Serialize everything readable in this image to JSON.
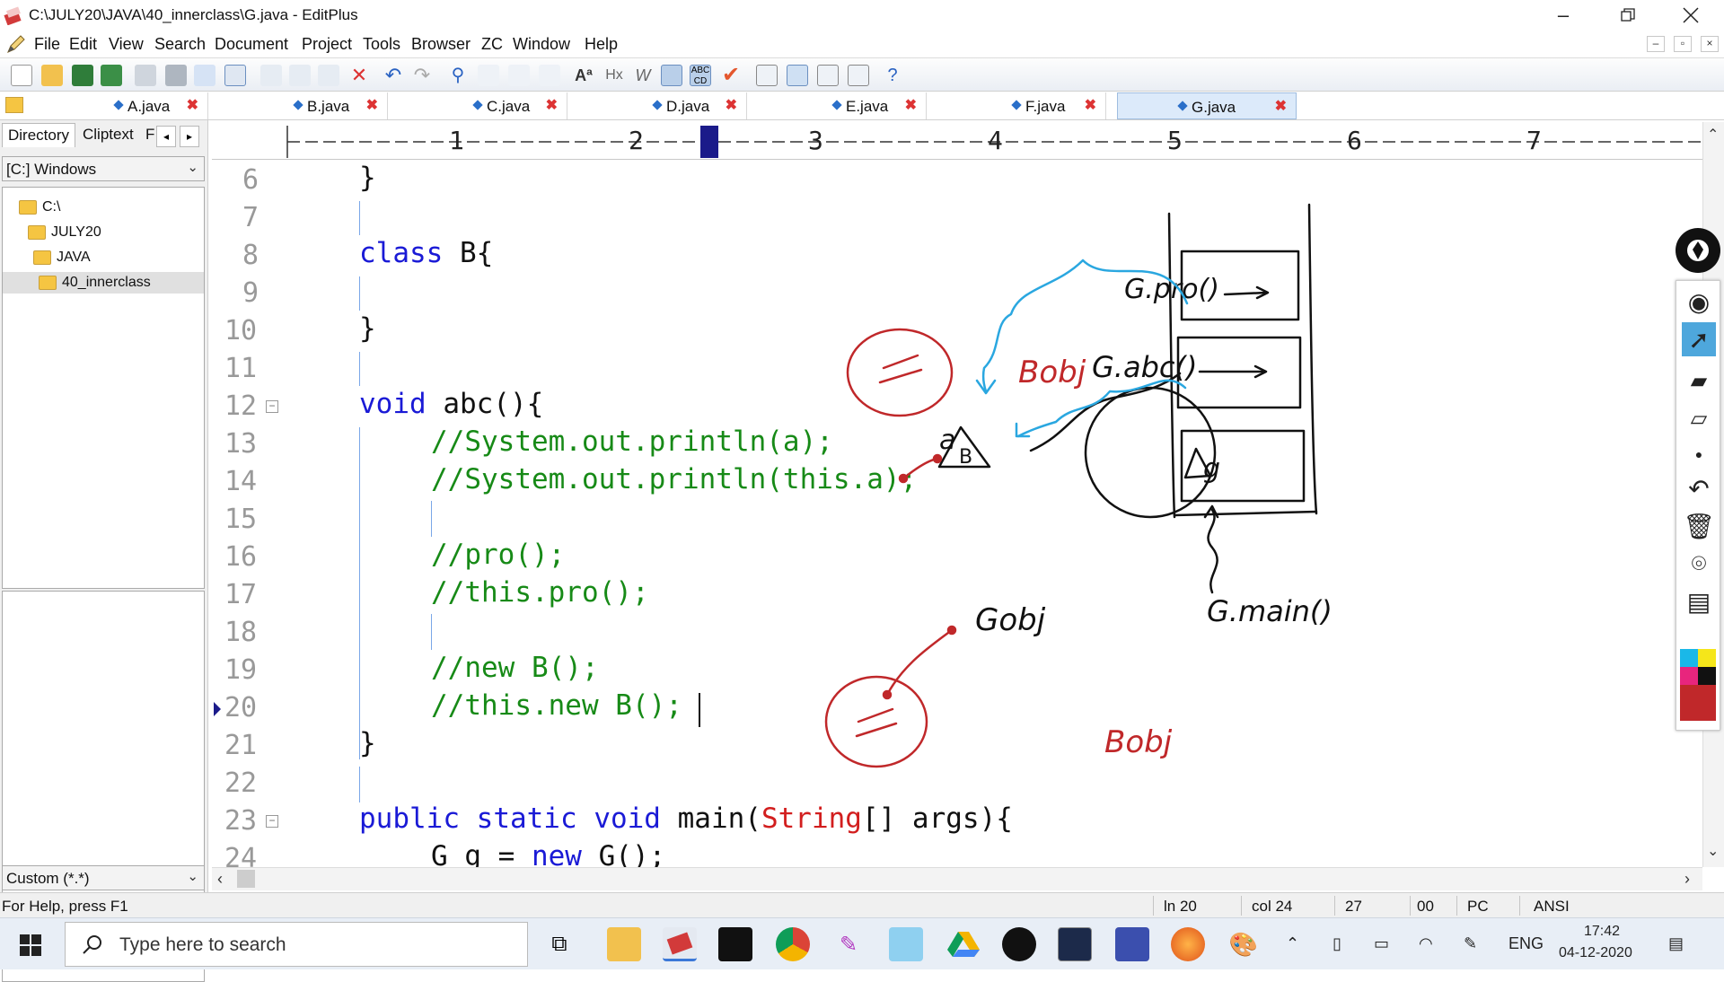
{
  "window": {
    "title": "C:\\JULY20\\JAVA\\40_innerclass\\G.java - EditPlus"
  },
  "menu": [
    "File",
    "Edit",
    "View",
    "Search",
    "Document",
    "Project",
    "Tools",
    "Browser",
    "ZC",
    "Window",
    "Help"
  ],
  "tabs": [
    {
      "label": "A.java",
      "active": false
    },
    {
      "label": "B.java",
      "active": false
    },
    {
      "label": "C.java",
      "active": false
    },
    {
      "label": "D.java",
      "active": false
    },
    {
      "label": "E.java",
      "active": false
    },
    {
      "label": "F.java",
      "active": false
    },
    {
      "label": "G.java",
      "active": true
    }
  ],
  "sidebar": {
    "tabs": [
      "Directory",
      "Cliptext",
      "F"
    ],
    "drive": "[C:] Windows",
    "tree": [
      "C:\\",
      "JULY20",
      "JAVA",
      "40_innerclass"
    ],
    "filter": "Custom (*.*)"
  },
  "ruler": [
    "1",
    "2",
    "3",
    "4",
    "5",
    "6",
    "7"
  ],
  "code": {
    "line_numbers": [
      "6",
      "7",
      "8",
      "9",
      "10",
      "11",
      "12",
      "13",
      "14",
      "15",
      "16",
      "17",
      "18",
      "19",
      "20",
      "21",
      "22",
      "23",
      "24"
    ],
    "l6": "}",
    "l8a": "class",
    "l8b": " B{",
    "l10": "}",
    "l12a": "void",
    "l12b": " abc(){",
    "l13": "//System.out.println(a);",
    "l14": "//System.out.println(this.a);",
    "l16": "//pro();",
    "l17": "//this.pro();",
    "l19": "//new B();",
    "l20": "//this.new B();",
    "l21": "}",
    "l23a": "public",
    "l23b": "static",
    "l23c": "void",
    "l23d": " main(",
    "l23e": "String",
    "l23f": "[] args){",
    "l24a": "G g = ",
    "l24b": "new",
    "l24c": " G();"
  },
  "annotations": {
    "bobj_top": "Bobj",
    "bobj_bottom": "Bobj",
    "gobj": "Gobj",
    "stack_pro": "G.pro()",
    "stack_abc": "G.abc()",
    "stack_main": "G.main()",
    "obj_a": "a",
    "obj_b": "B",
    "frame_g": "g"
  },
  "status": {
    "help": "For Help, press F1",
    "line": "ln 20",
    "col": "col 24",
    "total": "27",
    "code": "00",
    "mode": "PC",
    "encoding": "ANSI"
  },
  "taskbar": {
    "search_placeholder": "Type here to search",
    "lang": "ENG",
    "time": "17:42",
    "date": "04-12-2020"
  },
  "colors": {
    "keyword": "#1a1ad6",
    "comment": "#178a17",
    "string_type": "#d21e1e",
    "ink_red": "#c0282a",
    "ink_blue": "#2aa7e0"
  }
}
